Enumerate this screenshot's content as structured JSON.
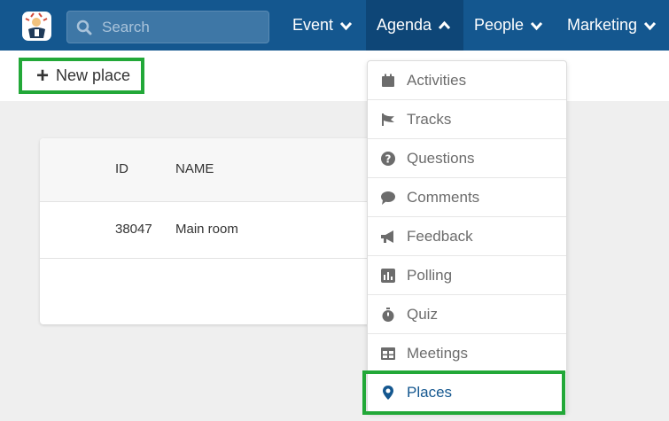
{
  "search": {
    "placeholder": "Search"
  },
  "nav": {
    "items": [
      {
        "label": "Event"
      },
      {
        "label": "Agenda",
        "active": true
      },
      {
        "label": "People"
      },
      {
        "label": "Marketing"
      }
    ]
  },
  "toolbar": {
    "new_place_label": "New place"
  },
  "table": {
    "columns": [
      "ID",
      "NAME"
    ],
    "rows": [
      {
        "id": "38047",
        "name": "Main room"
      }
    ]
  },
  "agenda_menu": {
    "items": [
      {
        "label": "Activities",
        "icon": "calendar-icon"
      },
      {
        "label": "Tracks",
        "icon": "flag-icon"
      },
      {
        "label": "Questions",
        "icon": "question-circle-icon"
      },
      {
        "label": "Comments",
        "icon": "comment-icon"
      },
      {
        "label": "Feedback",
        "icon": "megaphone-icon"
      },
      {
        "label": "Polling",
        "icon": "bar-chart-icon"
      },
      {
        "label": "Quiz",
        "icon": "stopwatch-icon"
      },
      {
        "label": "Meetings",
        "icon": "table-icon"
      },
      {
        "label": "Places",
        "icon": "map-marker-icon",
        "selected": true
      }
    ]
  },
  "colors": {
    "topbar": "#14578f",
    "accent_highlight": "#22a838",
    "selected_text": "#14578f"
  }
}
